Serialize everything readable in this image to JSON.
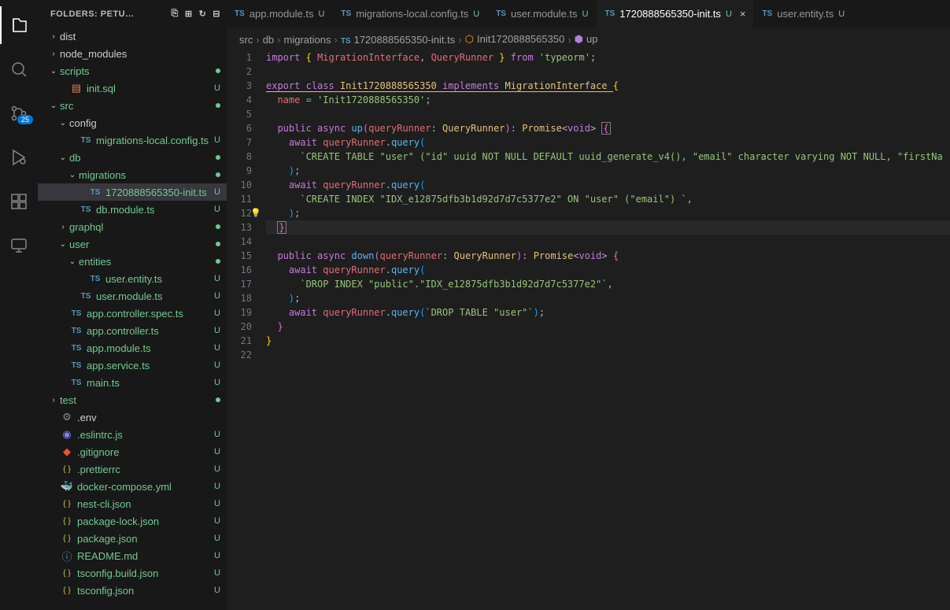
{
  "activity": {
    "scm_badge": "25"
  },
  "sidebar": {
    "title": "FOLDERS: PETU…",
    "tree": [
      {
        "label": "dist",
        "type": "folder",
        "indent": 1,
        "collapsed": true
      },
      {
        "label": "node_modules",
        "type": "folder",
        "indent": 1,
        "collapsed": true
      },
      {
        "label": "scripts",
        "type": "folder",
        "indent": 1,
        "collapsed": false,
        "dot": true
      },
      {
        "label": "init.sql",
        "type": "sql",
        "indent": 2,
        "status": "U"
      },
      {
        "label": "src",
        "type": "folder",
        "indent": 1,
        "collapsed": false,
        "dot": true
      },
      {
        "label": "config",
        "type": "folder",
        "indent": 2,
        "collapsed": false
      },
      {
        "label": "migrations-local.config.ts",
        "type": "ts",
        "indent": 3,
        "status": "U"
      },
      {
        "label": "db",
        "type": "folder",
        "indent": 2,
        "collapsed": false,
        "dot": true
      },
      {
        "label": "migrations",
        "type": "folder",
        "indent": 3,
        "collapsed": false,
        "dot": true
      },
      {
        "label": "1720888565350-init.ts",
        "type": "ts",
        "indent": 4,
        "status": "U",
        "selected": true
      },
      {
        "label": "db.module.ts",
        "type": "ts",
        "indent": 3,
        "status": "U"
      },
      {
        "label": "graphql",
        "type": "folder",
        "indent": 2,
        "collapsed": true,
        "dot": true
      },
      {
        "label": "user",
        "type": "folder",
        "indent": 2,
        "collapsed": false,
        "dot": true
      },
      {
        "label": "entities",
        "type": "folder",
        "indent": 3,
        "collapsed": false,
        "dot": true
      },
      {
        "label": "user.entity.ts",
        "type": "ts",
        "indent": 4,
        "status": "U"
      },
      {
        "label": "user.module.ts",
        "type": "ts",
        "indent": 3,
        "status": "U"
      },
      {
        "label": "app.controller.spec.ts",
        "type": "ts",
        "indent": 2,
        "status": "U"
      },
      {
        "label": "app.controller.ts",
        "type": "ts",
        "indent": 2,
        "status": "U"
      },
      {
        "label": "app.module.ts",
        "type": "ts",
        "indent": 2,
        "status": "U"
      },
      {
        "label": "app.service.ts",
        "type": "ts",
        "indent": 2,
        "status": "U"
      },
      {
        "label": "main.ts",
        "type": "ts",
        "indent": 2,
        "status": "U"
      },
      {
        "label": "test",
        "type": "folder",
        "indent": 1,
        "collapsed": true,
        "dot": true
      },
      {
        "label": ".env",
        "type": "gear",
        "indent": 1
      },
      {
        "label": ".eslintrc.js",
        "type": "eslint",
        "indent": 1,
        "status": "U"
      },
      {
        "label": ".gitignore",
        "type": "git",
        "indent": 1,
        "status": "U"
      },
      {
        "label": ".prettierrc",
        "type": "json",
        "indent": 1,
        "status": "U"
      },
      {
        "label": "docker-compose.yml",
        "type": "yml",
        "indent": 1,
        "status": "U"
      },
      {
        "label": "nest-cli.json",
        "type": "json",
        "indent": 1,
        "status": "U"
      },
      {
        "label": "package-lock.json",
        "type": "json",
        "indent": 1,
        "status": "U"
      },
      {
        "label": "package.json",
        "type": "json",
        "indent": 1,
        "status": "U"
      },
      {
        "label": "README.md",
        "type": "md",
        "indent": 1,
        "status": "U"
      },
      {
        "label": "tsconfig.build.json",
        "type": "json",
        "indent": 1,
        "status": "U"
      },
      {
        "label": "tsconfig.json",
        "type": "json",
        "indent": 1,
        "status": "U"
      }
    ]
  },
  "tabs": [
    {
      "label": "app.module.ts",
      "status": "U",
      "active": false
    },
    {
      "label": "migrations-local.config.ts",
      "status": "U",
      "active": false
    },
    {
      "label": "user.module.ts",
      "status": "U",
      "active": false
    },
    {
      "label": "1720888565350-init.ts",
      "status": "U",
      "active": true,
      "close": true
    },
    {
      "label": "user.entity.ts",
      "status": "U",
      "active": false
    }
  ],
  "breadcrumb": [
    {
      "text": "src"
    },
    {
      "text": "db"
    },
    {
      "text": "migrations"
    },
    {
      "text": "1720888565350-init.ts",
      "icon": "ts"
    },
    {
      "text": "Init1720888565350",
      "icon": "class"
    },
    {
      "text": "up",
      "icon": "method"
    }
  ],
  "code": {
    "lines": 22,
    "raw": [
      "import { MigrationInterface, QueryRunner } from 'typeorm';",
      "",
      "export class Init1720888565350 implements MigrationInterface {",
      "  name = 'Init1720888565350';",
      "",
      "  public async up(queryRunner: QueryRunner): Promise<void> {",
      "    await queryRunner.query(",
      "      `CREATE TABLE \"user\" (\"id\" uuid NOT NULL DEFAULT uuid_generate_v4(), \"email\" character varying NOT NULL, \"firstNa",
      "    );",
      "    await queryRunner.query(",
      "      `CREATE INDEX \"IDX_e12875dfb3b1d92d7d7c5377e2\" ON \"user\" (\"email\") `,",
      "    );",
      "  }",
      "",
      "  public async down(queryRunner: QueryRunner): Promise<void> {",
      "    await queryRunner.query(",
      "      `DROP INDEX \"public\".\"IDX_e12875dfb3b1d92d7d7c5377e2\"`,",
      "    );",
      "    await queryRunner.query(`DROP TABLE \"user\"`);",
      "  }",
      "}",
      ""
    ]
  }
}
